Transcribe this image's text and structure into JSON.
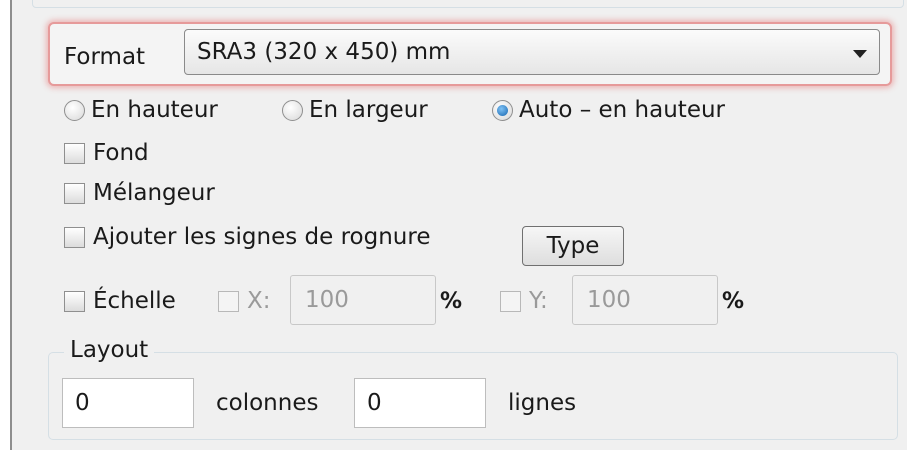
{
  "format": {
    "label": "Format",
    "value": "SRA3 (320 x 450) mm"
  },
  "orientation": {
    "options": [
      "En hauteur",
      "En largeur",
      "Auto – en hauteur"
    ],
    "selected": "Auto – en hauteur"
  },
  "options": {
    "fond": {
      "label": "Fond",
      "checked": false
    },
    "melangeur": {
      "label": "Mélangeur",
      "checked": false
    },
    "rognure": {
      "label": "Ajouter les signes de rognure",
      "checked": false
    },
    "type_button": "Type"
  },
  "scale": {
    "label": "Échelle",
    "checked": false,
    "x_label": "X:",
    "x_value": "100",
    "x_unit": "%",
    "y_label": "Y:",
    "y_value": "100",
    "y_unit": "%"
  },
  "layout": {
    "title": "Layout",
    "columns_value": "0",
    "columns_label": "colonnes",
    "rows_value": "0",
    "rows_label": "lignes"
  }
}
